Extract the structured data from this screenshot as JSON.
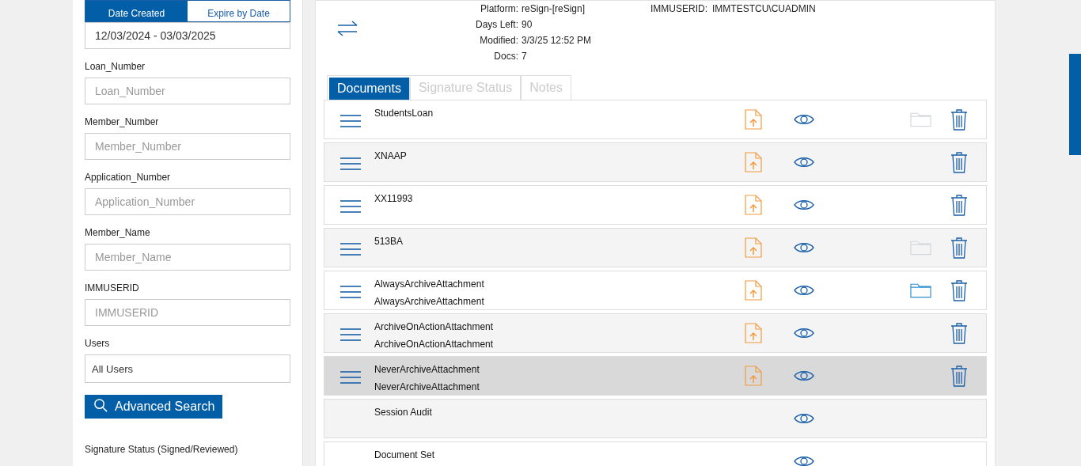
{
  "filters": {
    "date_tabs": [
      {
        "label": "Date Created",
        "selected": true
      },
      {
        "label": "Expire by Date",
        "selected": false
      }
    ],
    "date_range": "12/03/2024 - 03/03/2025",
    "fields": [
      {
        "label": "Loan_Number",
        "placeholder": "Loan_Number"
      },
      {
        "label": "Member_Number",
        "placeholder": "Member_Number"
      },
      {
        "label": "Application_Number",
        "placeholder": "Application_Number"
      },
      {
        "label": "Member_Name",
        "placeholder": "Member_Name"
      },
      {
        "label": "IMMUSERID",
        "placeholder": "IMMUSERID"
      },
      {
        "label": "Users",
        "value": "All Users"
      }
    ],
    "search_button": "Advanced Search",
    "section_label": "Signature Status (Signed/Reviewed)"
  },
  "details": {
    "left": [
      {
        "label": "Platform:",
        "value": "reSign-[reSign]"
      },
      {
        "label": "Days Left:",
        "value": "90"
      },
      {
        "label": "Modified:",
        "value": "3/3/25 12:52 PM"
      },
      {
        "label": "Docs:",
        "value": "7"
      }
    ],
    "right": [
      {
        "label": "IMMUSERID:",
        "value": "IMMTESTCU\\CUADMIN"
      }
    ]
  },
  "tabs": [
    {
      "label": "Documents",
      "selected": true
    },
    {
      "label": "Signature Status",
      "selected": false
    },
    {
      "label": "Notes",
      "selected": false
    }
  ],
  "documents": [
    {
      "lines": [
        "StudentsLoan"
      ],
      "kind": "document",
      "folder_disabled": true,
      "selected": false
    },
    {
      "lines": [
        "XNAAP"
      ],
      "kind": "document",
      "selected": false
    },
    {
      "lines": [
        "XX11993"
      ],
      "kind": "document",
      "selected": false
    },
    {
      "lines": [
        "513BA"
      ],
      "kind": "document",
      "folder_disabled": true,
      "selected": false
    },
    {
      "lines": [
        "AlwaysArchiveAttachment",
        "AlwaysArchiveAttachment"
      ],
      "kind": "document",
      "folder_disabled": false,
      "selected": false
    },
    {
      "lines": [
        "ArchiveOnActionAttachment",
        "ArchiveOnActionAttachment"
      ],
      "kind": "document",
      "selected": false
    },
    {
      "lines": [
        "NeverArchiveAttachment",
        "NeverArchiveAttachment"
      ],
      "kind": "document",
      "selected": true
    },
    {
      "lines": [
        "Session Audit"
      ],
      "kind": "audit",
      "selected": false
    },
    {
      "lines": [
        "Document Set"
      ],
      "kind": "audit",
      "selected": false
    }
  ]
}
